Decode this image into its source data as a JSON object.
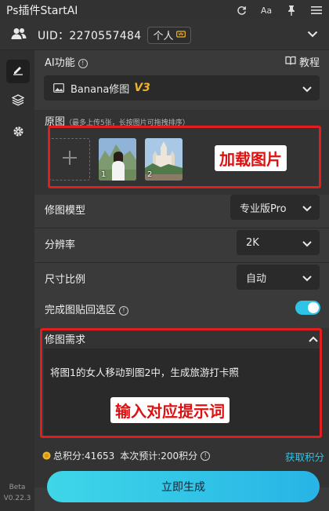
{
  "titlebar": {
    "title": "Ps插件StartAI"
  },
  "user": {
    "uid_label": "UID：2270557484",
    "account_type": "个人"
  },
  "ai_function": {
    "label": "AI功能",
    "tutorial_label": "教程",
    "selected_model": "Banana修图",
    "version_badge": "V3"
  },
  "source_images": {
    "label": "原图",
    "hint": "（最多上传5张，长按图片可拖拽排序）",
    "thumbnails": [
      {
        "index": "1"
      },
      {
        "index": "2"
      }
    ],
    "annotation": "加载图片"
  },
  "settings": {
    "model": {
      "label": "修图模型",
      "value": "专业版Pro"
    },
    "resolution": {
      "label": "分辨率",
      "value": "2K"
    },
    "aspect_ratio": {
      "label": "尺寸比例",
      "value": "自动"
    },
    "paste_back": {
      "label": "完成图贴回选区",
      "enabled": true
    }
  },
  "prompt": {
    "label": "修图需求",
    "text": "将图1的女人移动到图2中，生成旅游打卡照",
    "annotation": "输入对应提示词"
  },
  "footer": {
    "total_points": "总积分:41653",
    "estimate": "本次预计:200积分",
    "get_points": "获取积分",
    "generate_label": "立即生成"
  },
  "sidebar": {
    "version_beta": "Beta",
    "version_number": "V0.22.3"
  },
  "colors": {
    "accent": "#2ec4e6",
    "annotation_red": "#e01e1e",
    "version_yellow": "#f0b429"
  }
}
